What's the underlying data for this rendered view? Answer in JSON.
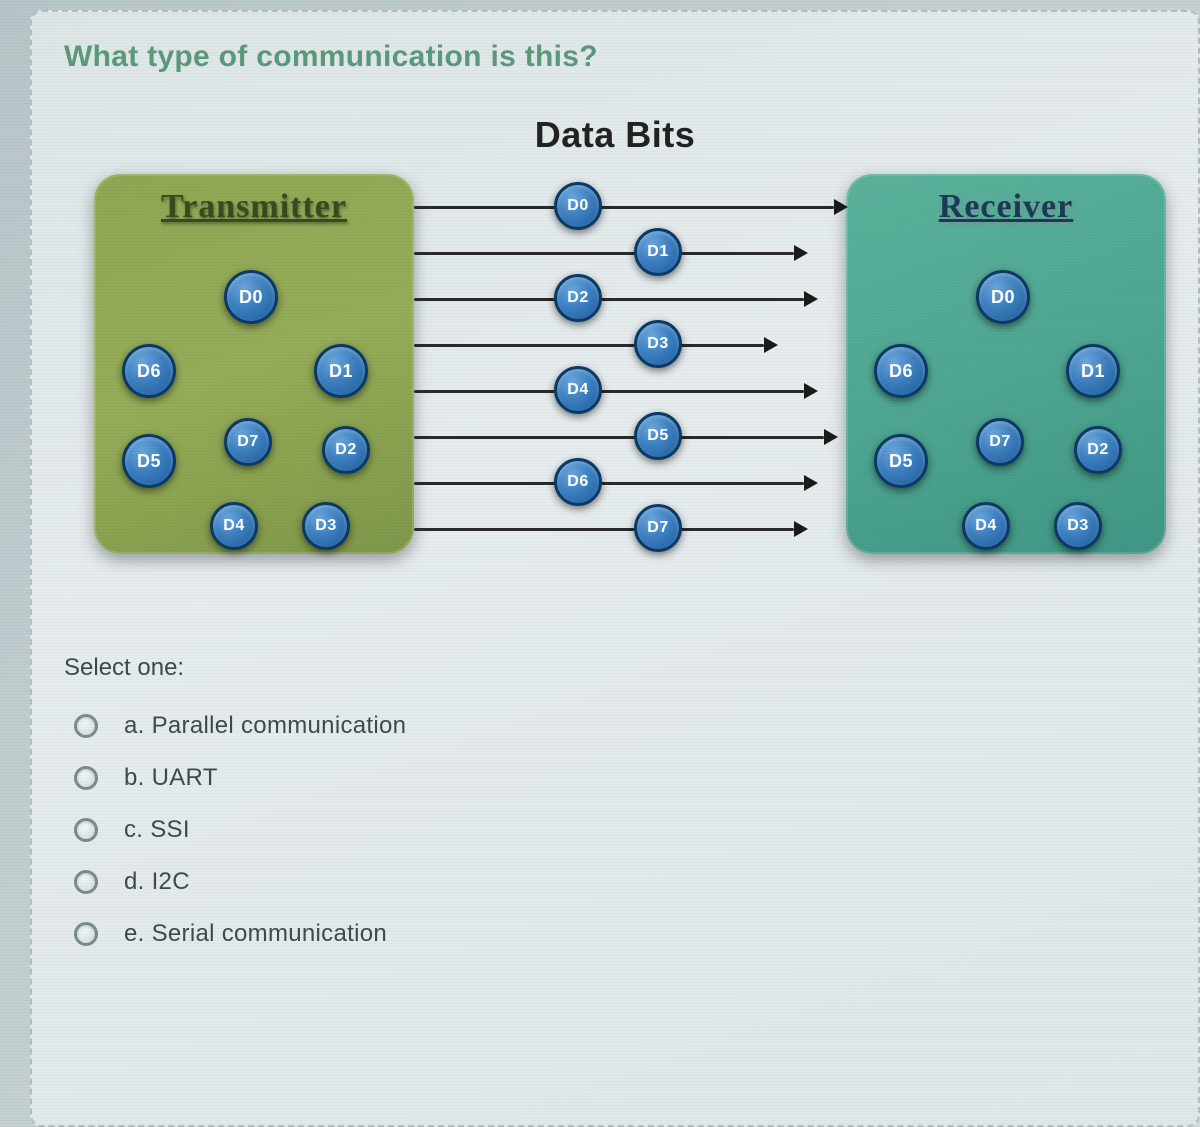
{
  "question": "What type of communication is this?",
  "diagram": {
    "channel_title": "Data Bits",
    "transmitter_label": "Transmitter",
    "receiver_label": "Receiver",
    "inner_bits": [
      "D0",
      "D1",
      "D2",
      "D3",
      "D4",
      "D5",
      "D6",
      "D7"
    ],
    "channel_bits": [
      "D0",
      "D1",
      "D2",
      "D3",
      "D4",
      "D5",
      "D6",
      "D7"
    ]
  },
  "select_label": "Select one:",
  "options": [
    {
      "key": "a",
      "text": "a. Parallel communication"
    },
    {
      "key": "b",
      "text": "b. UART"
    },
    {
      "key": "c",
      "text": "c. SSI"
    },
    {
      "key": "d",
      "text": "d. I2C"
    },
    {
      "key": "e",
      "text": "e. Serial communication"
    }
  ]
}
